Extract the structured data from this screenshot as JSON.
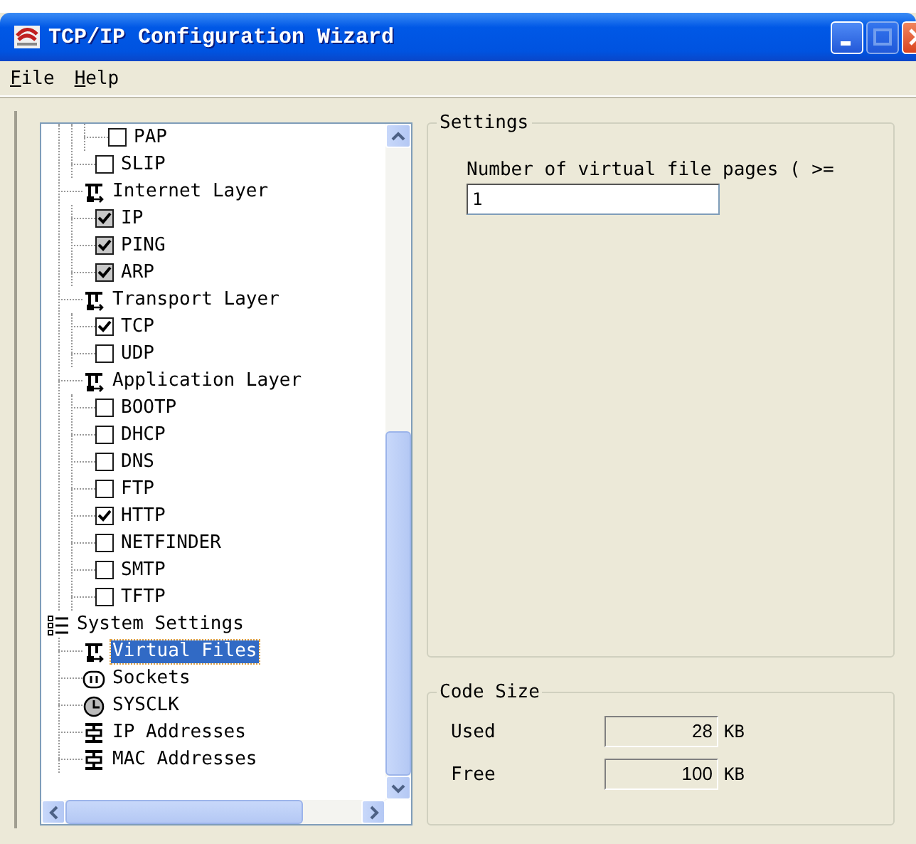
{
  "window": {
    "title": "TCP/IP Configuration Wizard"
  },
  "menu": [
    {
      "label": "File"
    },
    {
      "label": "Help"
    }
  ],
  "tree": [
    {
      "kind": "offscreen",
      "children": [
        {
          "kind": "offscreen",
          "children": [
            {
              "kind": "offscreen",
              "children": [
                {
                  "kind": "checkbox",
                  "label": "PAP",
                  "checked": false,
                  "disabled": false,
                  "selected": false
                }
              ]
            },
            {
              "kind": "checkbox",
              "label": "SLIP",
              "checked": false,
              "disabled": false,
              "selected": false
            }
          ]
        },
        {
          "kind": "layer",
          "label": "Internet Layer",
          "selected": false,
          "children": [
            {
              "kind": "checkbox",
              "label": "IP",
              "checked": true,
              "disabled": true,
              "selected": false
            },
            {
              "kind": "checkbox",
              "label": "PING",
              "checked": true,
              "disabled": true,
              "selected": false
            },
            {
              "kind": "checkbox",
              "label": "ARP",
              "checked": true,
              "disabled": true,
              "selected": false
            }
          ]
        },
        {
          "kind": "layer",
          "label": "Transport Layer",
          "selected": false,
          "children": [
            {
              "kind": "checkbox",
              "label": "TCP",
              "checked": true,
              "disabled": false,
              "selected": false
            },
            {
              "kind": "checkbox",
              "label": "UDP",
              "checked": false,
              "disabled": false,
              "selected": false
            }
          ]
        },
        {
          "kind": "layer",
          "label": "Application Layer",
          "selected": false,
          "children": [
            {
              "kind": "checkbox",
              "label": "BOOTP",
              "checked": false,
              "disabled": false,
              "selected": false
            },
            {
              "kind": "checkbox",
              "label": "DHCP",
              "checked": false,
              "disabled": false,
              "selected": false
            },
            {
              "kind": "checkbox",
              "label": "DNS",
              "checked": false,
              "disabled": false,
              "selected": false
            },
            {
              "kind": "checkbox",
              "label": "FTP",
              "checked": false,
              "disabled": false,
              "selected": false
            },
            {
              "kind": "checkbox",
              "label": "HTTP",
              "checked": true,
              "disabled": false,
              "selected": false
            },
            {
              "kind": "checkbox",
              "label": "NETFINDER",
              "checked": false,
              "disabled": false,
              "selected": false
            },
            {
              "kind": "checkbox",
              "label": "SMTP",
              "checked": false,
              "disabled": false,
              "selected": false
            },
            {
              "kind": "checkbox",
              "label": "TFTP",
              "checked": false,
              "disabled": false,
              "selected": false
            }
          ]
        }
      ]
    },
    {
      "kind": "settings",
      "label": "System Settings",
      "selected": false,
      "children": [
        {
          "kind": "layer",
          "label": "Virtual Files",
          "selected": true
        },
        {
          "kind": "socket",
          "label": "Sockets",
          "selected": false
        },
        {
          "kind": "clock",
          "label": "SYSCLK",
          "selected": false
        },
        {
          "kind": "address",
          "label": "IP Addresses",
          "selected": false
        },
        {
          "kind": "address",
          "label": "MAC Addresses",
          "selected": false
        }
      ]
    }
  ],
  "settings": {
    "title": "Settings",
    "label": "Number of virtual file pages ( >=",
    "value": "1"
  },
  "code_size": {
    "title": "Code Size",
    "rows": [
      {
        "label": "Used",
        "value": "28",
        "unit": "KB"
      },
      {
        "label": "Free",
        "value": "100",
        "unit": "KB"
      }
    ]
  }
}
